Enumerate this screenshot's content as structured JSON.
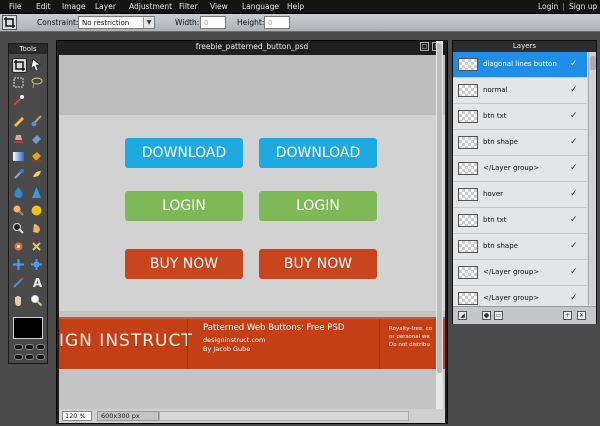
{
  "menubar": {
    "items": [
      "File",
      "Edit",
      "Image",
      "Layer",
      "Adjustment",
      "Filter",
      "View",
      "Language",
      "Help"
    ],
    "login": "Login",
    "separator": "|",
    "signup": "Sign up"
  },
  "options": {
    "constraint_label": "Constraint:",
    "constraint_value": "No restriction",
    "width_label": "Width:",
    "width_value": "0",
    "height_label": "Height:",
    "height_value": "0"
  },
  "tools": {
    "title": "Tools",
    "icons": [
      "crop-icon",
      "move-icon",
      "marquee-icon",
      "lasso-icon",
      "magic-wand-icon",
      "pencil-icon",
      "brush-icon",
      "clone-stamp-icon",
      "eraser-icon",
      "replace-color-icon",
      "gradient-icon",
      "paint-bucket-icon",
      "color-picker-icon",
      "smudge-icon",
      "blur-icon",
      "sharpen-icon",
      "sponge-icon",
      "dodge-icon",
      "red-eye-icon",
      "burn-icon",
      "spot-heal-icon",
      "bloat-icon",
      "pinch-icon",
      "drawing-icon",
      "text-icon",
      "hand-icon",
      "zoom-icon"
    ],
    "foreground_color": "#000000"
  },
  "document": {
    "title": "freebie_patterned_button_psd",
    "zoom": "120",
    "zoom_unit": "%",
    "size": "600x300 px",
    "buttons": {
      "download_1": "DOWNLOAD",
      "download_2": "DOWNLOAD",
      "login_1": "LOGIN",
      "login_2": "LOGIN",
      "buy_1": "BUY NOW",
      "buy_2": "BUY NOW"
    },
    "banner": {
      "brand": "IGN INSTRUCT",
      "title": "Patterned Web Buttons: Free PSD",
      "site": "designinstruct.com",
      "author": "By Jacob Gube",
      "right_1": "Royalty-free, co",
      "right_2": "or personal we",
      "right_3": "Do not distribu"
    },
    "colors": {
      "blue": "#1ea9e1",
      "green": "#7fb856",
      "red": "#c8451d"
    }
  },
  "layers": {
    "title": "Layers",
    "items": [
      {
        "name": "diagonal lines button",
        "selected": true
      },
      {
        "name": "normal",
        "selected": false
      },
      {
        "name": "btn txt",
        "selected": false
      },
      {
        "name": "btn shape",
        "selected": false
      },
      {
        "name": "</Layer group>",
        "selected": false
      },
      {
        "name": "hover",
        "selected": false
      },
      {
        "name": "btn txt",
        "selected": false
      },
      {
        "name": "btn shape",
        "selected": false
      },
      {
        "name": "</Layer group>",
        "selected": false
      },
      {
        "name": "</Layer group>",
        "selected": false
      }
    ],
    "check": "✓"
  }
}
